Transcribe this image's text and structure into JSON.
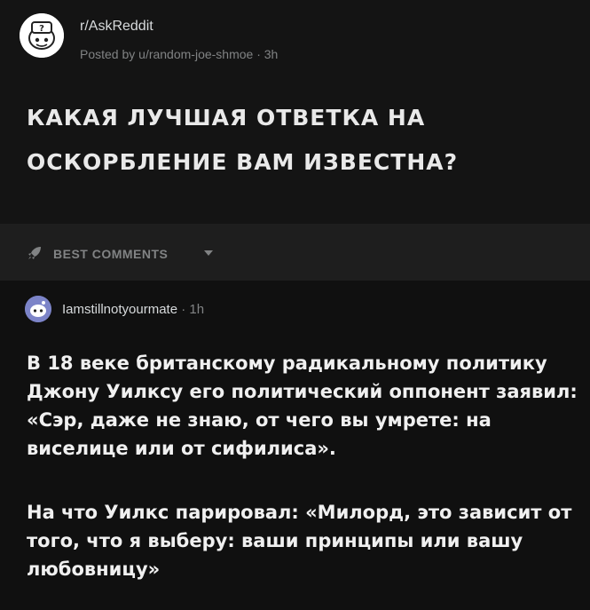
{
  "post": {
    "subreddit": "r/AskReddit",
    "posted_by": "Posted by u/random-joe-shmoe · 3h",
    "title": "Какая лучшая ответка на оскорбление вам известна?"
  },
  "comments_bar": {
    "sort_label": "BEST COMMENTS",
    "icon": "rocket-icon",
    "chevron": "chevron-down-icon"
  },
  "comment": {
    "author": "Iamstillnotyourmate",
    "time": "· 1h",
    "paragraph_1": "В 18 веке британскому радикальному политику Джону Уилксу его политический оппонент заявил: «Сэр, даже не знаю, от чего вы умрете: на виселице или от сифилиса».",
    "paragraph_2": "На что Уилкс парировал: «Милорд, это зависит от того, что я выберу: ваши принципы или вашу любовницу»"
  },
  "colors": {
    "background": "#101010",
    "header_bg": "#141414",
    "bar_bg": "#1e1e1e",
    "muted_text": "#818384"
  }
}
